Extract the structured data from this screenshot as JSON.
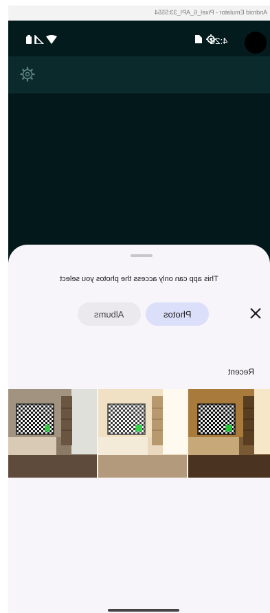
{
  "window": {
    "title": "Android Emulator - Pixel_6_API_33:5554"
  },
  "statusbar": {
    "time": "4:26",
    "icons": [
      "battery-icon",
      "signal-icon",
      "wifi-icon",
      "sim-card-icon",
      "gear-notification-icon"
    ]
  },
  "appbar": {
    "settings_icon": "gear-icon"
  },
  "photo_picker": {
    "notice": "This app can only access the photos you select",
    "tabs": [
      {
        "label": "Photos",
        "selected": true
      },
      {
        "label": "Albums",
        "selected": false
      }
    ],
    "close_icon": "close-icon",
    "section_title": "Recent",
    "photos": [
      {
        "variant": "warm"
      },
      {
        "variant": "bright"
      },
      {
        "variant": "dim"
      }
    ]
  },
  "colors": {
    "background_dark": "#02181a",
    "sheet": "#f7f4fa",
    "tab_selected": "#dcdff9",
    "tab_unselected": "#ebe8ee"
  }
}
